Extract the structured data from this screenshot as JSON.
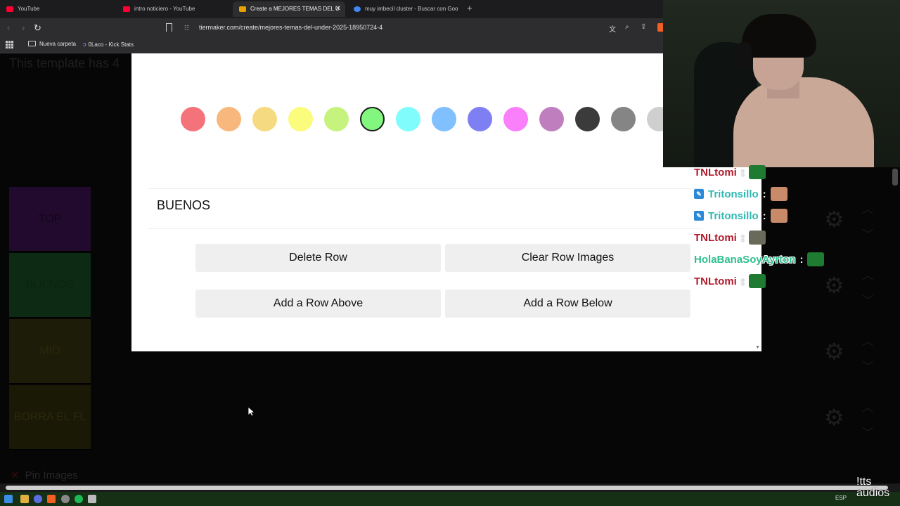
{
  "browser": {
    "tabs": [
      {
        "title": "YouTube",
        "color": "#ff0033"
      },
      {
        "title": "intro noticiero - YouTube",
        "color": "#ff0033"
      },
      {
        "title": "Create a MEJORES TEMAS DEL U",
        "color": "#e6a200",
        "active": true
      },
      {
        "title": "muy imbecil cluster - Buscar con Goo",
        "color": "#4285f4"
      }
    ],
    "url": "tiermaker.com/create/mejores-temas-del-under-2025-18950724-4",
    "bookmarks": [
      {
        "label": "Nueva carpeta",
        "icon": "folder-icon"
      },
      {
        "label": "0Laco - Kick Stats",
        "icon": "kick-icon"
      }
    ]
  },
  "background_page": {
    "heading": "This template has 4",
    "tiers": [
      {
        "label": "TOP"
      },
      {
        "label": "BUENOS"
      },
      {
        "label": "MID"
      },
      {
        "label": "BORRA EL FL"
      }
    ],
    "pin_images": "Pin Images"
  },
  "modal": {
    "colors": [
      "#f4737b",
      "#f8b77d",
      "#f6da82",
      "#fbfb7e",
      "#c6f37e",
      "#82f67e",
      "#80fcfc",
      "#80c0ff",
      "#7f7ff4",
      "#fa7ffa",
      "#bf7fbf",
      "#3b3b3b",
      "#858585",
      "#cfcfcf"
    ],
    "selected_color_index": 5,
    "row_label": "BUENOS",
    "buttons": {
      "delete_row": "Delete Row",
      "clear_row_images": "Clear Row Images",
      "add_row_above": "Add a Row Above",
      "add_row_below": "Add a Row Below"
    }
  },
  "chat": {
    "messages": [
      {
        "user": "TNLtomi",
        "user_color": "#b01a2c",
        "badge": false,
        "emote_color": "#1f7a32"
      },
      {
        "user": "Tritonsillo",
        "user_color": "#2fb8b2",
        "badge": true,
        "emote_color": "#c98a6a"
      },
      {
        "user": "Tritonsillo",
        "user_color": "#2fb8b2",
        "badge": true,
        "emote_color": "#c98a6a"
      },
      {
        "user": "TNLtomi",
        "user_color": "#b01a2c",
        "badge": false,
        "emote_color": "#6a6a5a"
      },
      {
        "user": "HolaBanaSoyAyrton",
        "user_color": "#2fbf8f",
        "badge": false,
        "emote_color": "#1f7a32"
      },
      {
        "user": "TNLtomi",
        "user_color": "#b01a2c",
        "badge": false,
        "emote_color": "#1f7a32"
      }
    ]
  },
  "taskbar": {
    "lang": "ESP",
    "watermark": "!tts\naudios"
  }
}
